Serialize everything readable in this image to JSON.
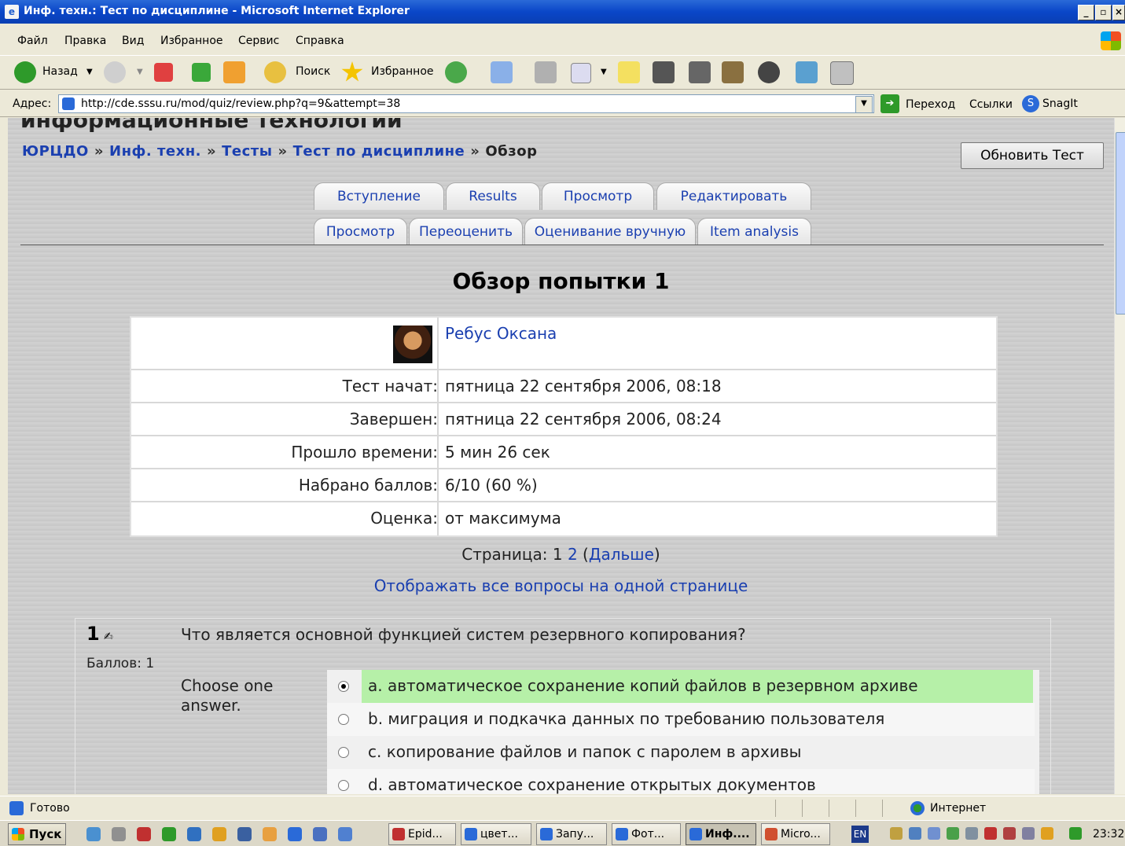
{
  "window": {
    "title": "Инф. техн.: Тест по дисциплине - Microsoft Internet Explorer",
    "controls": [
      "_",
      "▫",
      "×"
    ]
  },
  "menu": [
    "Файл",
    "Правка",
    "Вид",
    "Избранное",
    "Сервис",
    "Справка"
  ],
  "toolbar": {
    "back_label": "Назад",
    "search_label": "Поиск",
    "favorites_label": "Избранное"
  },
  "address": {
    "label": "Адрес:",
    "url": "http://cde.sssu.ru/mod/quiz/review.php?q=9&attempt=38",
    "go_label": "Переход",
    "links_label": "Ссылки",
    "snagit_label": "SnagIt"
  },
  "page": {
    "site_title": "информационные технологии",
    "breadcrumb": [
      "ЮРЦДО",
      "Инф. техн.",
      "Тесты",
      "Тест по дисциплине",
      "Обзор"
    ],
    "breadcrumb_sep": "»",
    "update_button": "Обновить Тест",
    "tabs_row1": [
      "Вступление",
      "Results",
      "Просмотр",
      "Редактировать"
    ],
    "tabs_row2": [
      "Просмотр",
      "Переоценить",
      "Оценивание вручную",
      "Item analysis"
    ],
    "heading": "Обзор попытки 1",
    "user_name": "Ребус Оксана",
    "info": [
      {
        "label": "Тест начат:",
        "value": "пятница 22 сентября 2006, 08:18"
      },
      {
        "label": "Завершен:",
        "value": "пятница 22 сентября 2006, 08:24"
      },
      {
        "label": "Прошло времени:",
        "value": "5 мин 26 сек"
      },
      {
        "label": "Набрано баллов:",
        "value": "6/10 (60 %)"
      },
      {
        "label": "Оценка:",
        "value": "от максимума"
      }
    ],
    "pagination": {
      "label": "Страница:",
      "current": "1",
      "next_page": "2",
      "next_label": "Дальше"
    },
    "show_all": "Отображать все вопросы на одной странице",
    "question": {
      "number": "1",
      "edit_icon": "✍",
      "text": "Что является основной функцией систем резервного копирования?",
      "marks": "Баллов: 1",
      "prompt": "Choose one answer.",
      "answers": [
        {
          "text": "a. автоматическое сохранение копий файлов в резервном архиве",
          "selected": true,
          "correct": true
        },
        {
          "text": "b. миграция и подкачка данных по требованию пользователя",
          "selected": false,
          "correct": false
        },
        {
          "text": "c. копирование файлов и папок с паролем в архивы",
          "selected": false,
          "correct": false
        },
        {
          "text": "d. автоматическое сохранение открытых документов",
          "selected": false,
          "correct": false
        }
      ]
    }
  },
  "status": {
    "text": "Готово",
    "zone": "Интернет"
  },
  "taskbar": {
    "start": "Пуск",
    "tasks": [
      {
        "label": "Epid...",
        "active": false
      },
      {
        "label": "цвет...",
        "active": false
      },
      {
        "label": "Запу...",
        "active": false
      },
      {
        "label": "Фот...",
        "active": false
      },
      {
        "label": "Инф....",
        "active": true
      },
      {
        "label": "Micro...",
        "active": false
      }
    ],
    "lang": "EN",
    "clock": "23:32"
  },
  "colors": {
    "link": "#1a3fb0",
    "correct_answer_bg": "#b6f0a8",
    "titlebar": "#0a46c8"
  }
}
